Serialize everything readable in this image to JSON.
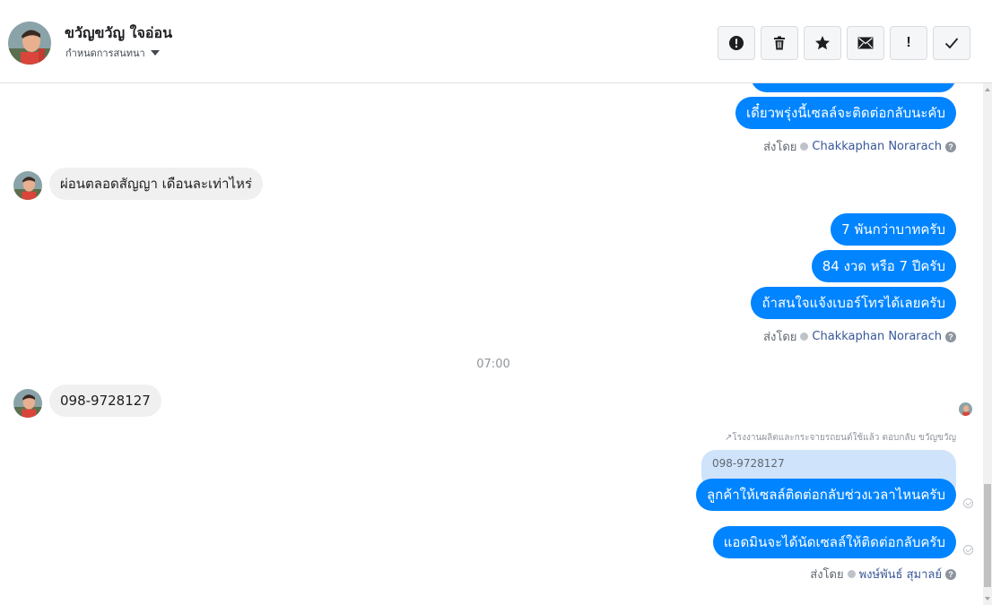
{
  "header": {
    "contact_name": "ขวัญขวัญ ใจอ่อน",
    "assign_label": "กำหนดการสนทนา",
    "toolbar": [
      {
        "name": "spam-button",
        "icon": "alert-circle-icon"
      },
      {
        "name": "delete-button",
        "icon": "trash-icon"
      },
      {
        "name": "star-button",
        "icon": "star-icon"
      },
      {
        "name": "mark-unread-button",
        "icon": "envelope-icon"
      },
      {
        "name": "follow-up-button",
        "icon": "exclamation-icon",
        "glyph": "!"
      },
      {
        "name": "mark-done-button",
        "icon": "checkmark-icon"
      }
    ]
  },
  "conversation": {
    "messages": {
      "m1": "เดี๋ยวพรุ่งนี้เซลล์จะติดต่อกลับนะคับ",
      "m2": "ผ่อนตลอดสัญญา เดือนละเท่าไหร่",
      "m3": "7 พันกว่าบาทครับ",
      "m4": "84 งวด หรือ 7 ปีครับ",
      "m5": "ถ้าสนใจแจ้งเบอร์โทรได้เลยครับ",
      "m6": "098-9728127",
      "m7": "ลูกค้าให้เซลล์ติดต่อกลับช่วงเวลาไหนครับ",
      "m8": "แอดมินจะได้นัดเซลล์ให้ติดต่อกลับครับ"
    },
    "sent_by_label": "ส่งโดย",
    "agents": {
      "a1": "Chakkaphan Norarach",
      "a2": "Chakkaphan Norarach",
      "a3": "พงษ์พันธ์ สุมาลย์"
    },
    "help_glyph": "?",
    "time_separator": "07:00",
    "reply_note": "โรงงานผลิตและกระจายรถยนต์ใช้แล้ว ตอบกลับ ขวัญขวัญ",
    "reply_icon": "reply-arrow-icon",
    "quoted_text": "098-9728127"
  },
  "colors": {
    "outgoing_bubble": "#0084ff",
    "incoming_bubble": "#f1f0f0",
    "quoted_bubble": "#cfe3fb",
    "agent_link": "#385898"
  }
}
